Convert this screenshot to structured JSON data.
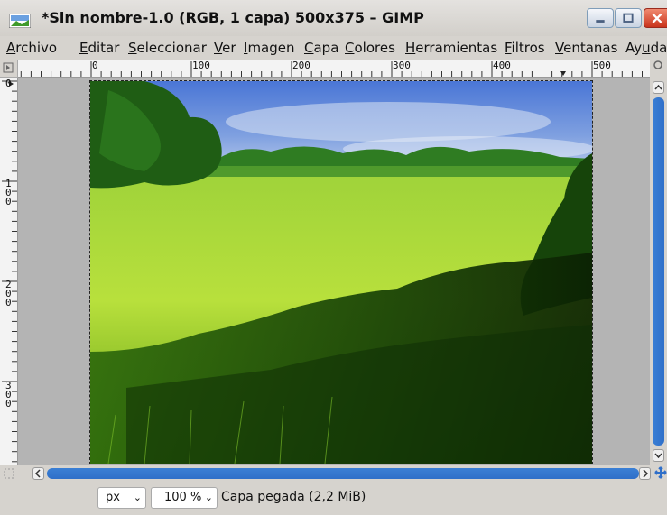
{
  "window": {
    "title": "*Sin nombre-1.0 (RGB, 1 capa) 500x375 – GIMP",
    "accent": "#2f6fc9",
    "close_color": "#d6422a"
  },
  "menu": {
    "items": [
      {
        "pre": "",
        "u": "A",
        "post": "rchivo"
      },
      {
        "pre": "",
        "u": "E",
        "post": "ditar"
      },
      {
        "pre": "",
        "u": "S",
        "post": "eleccionar"
      },
      {
        "pre": "",
        "u": "V",
        "post": "er"
      },
      {
        "pre": "",
        "u": "I",
        "post": "magen"
      },
      {
        "pre": "",
        "u": "C",
        "post": "apa"
      },
      {
        "pre": "",
        "u": "C",
        "post": "olores"
      },
      {
        "pre": "",
        "u": "H",
        "post": "erramientas"
      },
      {
        "pre": "",
        "u": "F",
        "post": "iltros"
      },
      {
        "pre": "",
        "u": "V",
        "post": "entanas"
      },
      {
        "pre": "Ay",
        "u": "u",
        "post": "da"
      }
    ]
  },
  "hruler": {
    "labels": [
      "0",
      "100",
      "200",
      "300",
      "400",
      "500"
    ]
  },
  "vruler": {
    "labels": [
      "0",
      "100",
      "200",
      "300"
    ]
  },
  "status": {
    "unit": "px",
    "zoom": "100 %",
    "message": "Capa pegada (2,2 MiB)"
  },
  "icons": [
    "app-icon",
    "minimize-icon",
    "maximize-icon",
    "close-icon",
    "navigate-icon",
    "quick-mask-icon",
    "zoom-arrow-icon"
  ]
}
